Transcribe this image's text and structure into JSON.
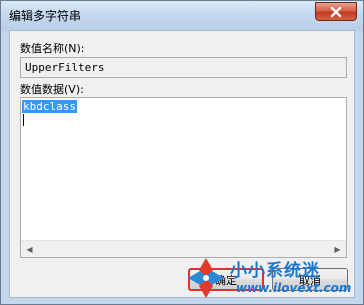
{
  "window": {
    "title": "编辑多字符串"
  },
  "value_name": {
    "label": "数值名称(N):",
    "value": "UpperFilters"
  },
  "value_data": {
    "label": "数值数据(V):",
    "value": "kbdclass"
  },
  "buttons": {
    "ok": "确定",
    "cancel": "取消"
  },
  "watermark": {
    "title": "小小系统迷",
    "url": "www.ilovext.com"
  },
  "colors": {
    "accent": "#1a78d0",
    "selection": "#3399ff",
    "close_button": "#c2391f",
    "highlight_border": "#e03030"
  },
  "icons": {
    "close": "close-icon",
    "scroll_left": "chevron-left-icon",
    "scroll_right": "chevron-right-icon",
    "watermark_logo": "pinwheel-logo-icon"
  }
}
